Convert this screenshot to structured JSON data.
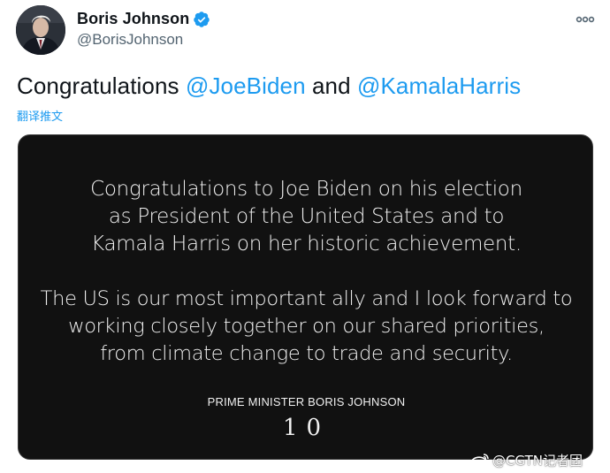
{
  "author": {
    "display_name": "Boris Johnson",
    "handle": "@BorisJohnson",
    "verified": true,
    "avatar_icon": "profile-photo"
  },
  "tweet": {
    "text_plain_1": "Congratulations ",
    "mention_1": "@JoeBiden",
    "text_plain_2": " and ",
    "mention_2": "@KamalaHarris",
    "translate_label": "翻译推文"
  },
  "media": {
    "paragraph1": [
      "Congratulations to Joe Biden on his election",
      "as President of the United States and to",
      "Kamala Harris on her historic achievement."
    ],
    "paragraph2": [
      "The US is our most important ally and I look forward to",
      "working closely together on our shared priorities,",
      "from climate change to trade and security."
    ],
    "signature": "PRIME MINISTER BORIS JOHNSON",
    "emblem": "10"
  },
  "watermark": {
    "text": "@CGTN记者团",
    "icon": "weibo-icon"
  },
  "colors": {
    "accent": "#1d9bf0",
    "text": "#0f1419",
    "secondary": "#536471",
    "card_bg": "#111111"
  }
}
